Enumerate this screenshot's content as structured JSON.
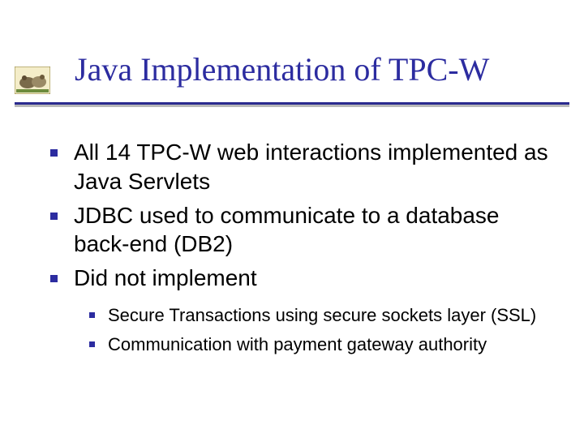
{
  "title": "Java Implementation of TPC-W",
  "bullets": [
    {
      "text": "All 14 TPC-W web interactions implemented as Java Servlets"
    },
    {
      "text": "JDBC used to communicate to a database back-end (DB2)"
    },
    {
      "text": "Did not implement"
    }
  ],
  "sub_bullets": [
    {
      "text": "Secure Transactions using secure sockets layer (SSL)"
    },
    {
      "text": "Communication with payment gateway authority"
    }
  ],
  "colors": {
    "accent": "#2c2ca0"
  }
}
